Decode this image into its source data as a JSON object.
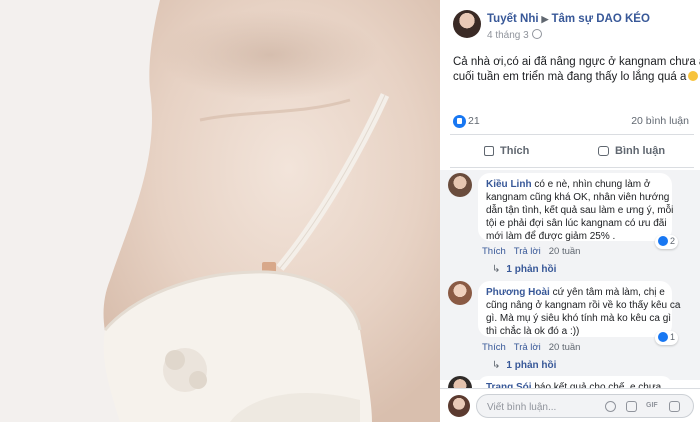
{
  "post": {
    "author": "Tuyết Nhi",
    "group": "Tâm sự DAO KÉO",
    "date": "4 tháng 3",
    "caption_lines": [
      "Cả nhà ơi,có ai đã nâng ngực ở kangnam chưa a?",
      "cuối tuần em triển mà đang thấy lo lắng quá a"
    ],
    "reaction_count": "21",
    "comment_count": "20 bình luận",
    "like_label": "Thích",
    "comment_label": "Bình luận"
  },
  "comments": [
    {
      "name": "Kiều Linh",
      "lines": [
        "có e nè, nhìn chung làm ở",
        "kangnam cũng khá OK, nhân viên hướng",
        "dẫn tận tình, kết quả sau làm e ưng ý, mỗi",
        "tội e phải đợi sân lúc kangnam có ưu đãi",
        "mới làm để được giảm 25% ."
      ],
      "likes": "2",
      "like_action": "Thích",
      "reply_action": "Trả lời",
      "age": "20 tuần",
      "replies": "1 phản hồi"
    },
    {
      "name": "Phương Hoài",
      "lines": [
        "cứ yên tâm mà làm, chị e",
        "cũng nâng ở kangnam rồi về ko thấy kêu ca",
        "gì. Mà mụ ý siêu khó tính mà ko kêu ca gì",
        "thì chắc là ok đó a :))"
      ],
      "likes": "1",
      "like_action": "Thích",
      "reply_action": "Trả lời",
      "age": "20 tuần",
      "replies": "1 phản hồi"
    },
    {
      "name": "Trang Sói",
      "lines": [
        "báo kết quả cho chế, e chưa ..."
      ]
    }
  ],
  "composer": {
    "placeholder": "Viết bình luận...",
    "tool_gif": "GIF"
  },
  "colors": {
    "link": "#385898",
    "like_blue": "#1877f2",
    "comment_bg": "#f2f3f5"
  }
}
